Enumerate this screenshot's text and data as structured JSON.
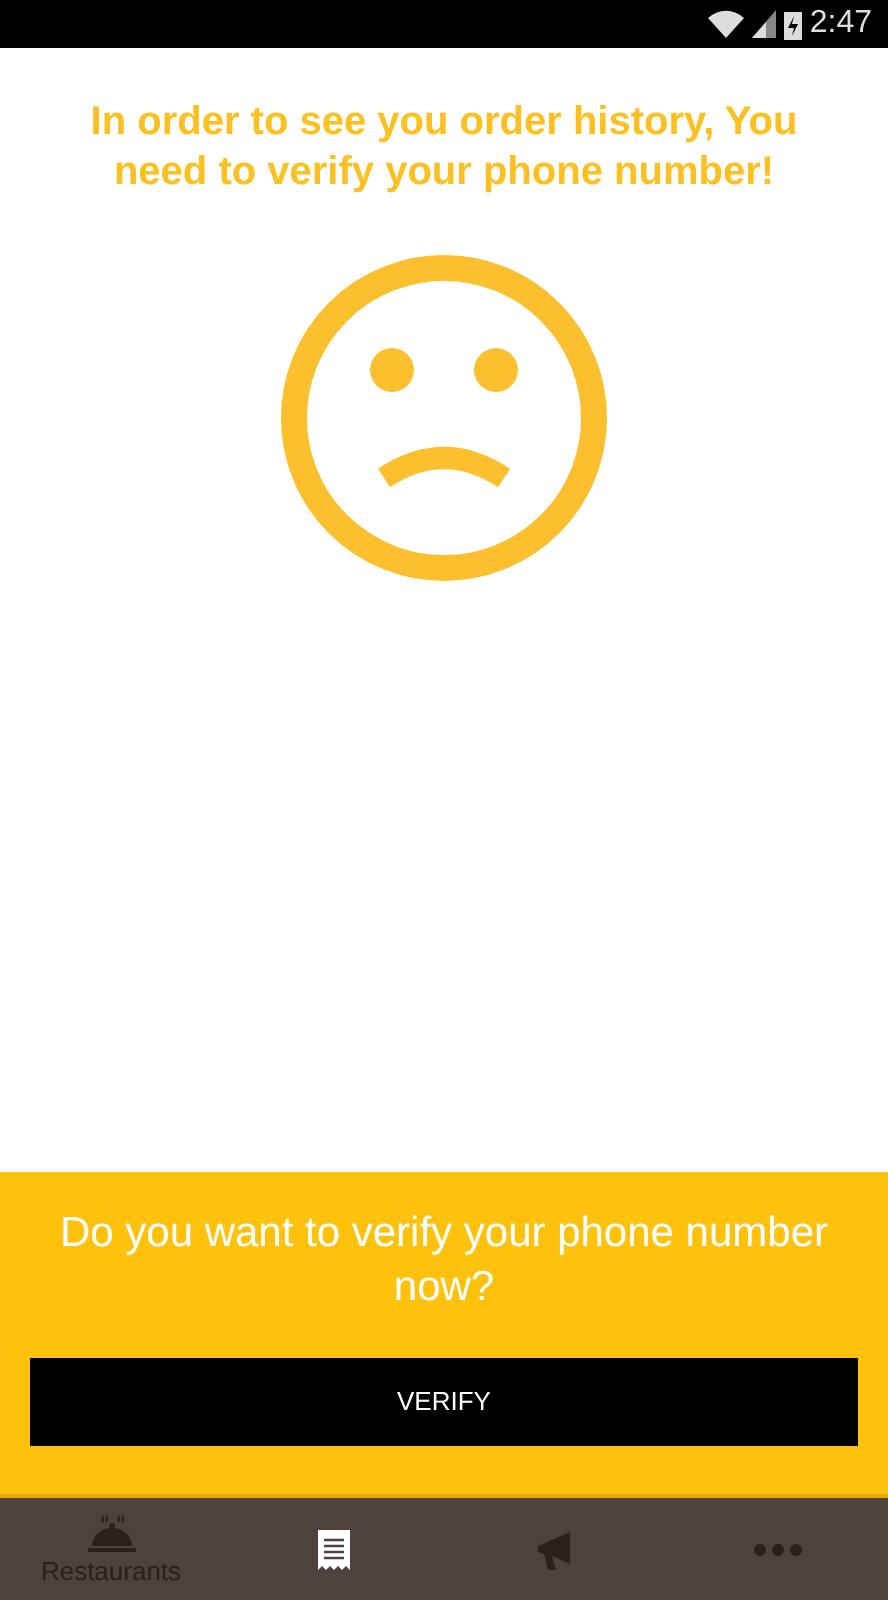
{
  "status_bar": {
    "time": "2:47"
  },
  "message": "In order to see you order history, You need to verify your phone number!",
  "prompt": {
    "question": "Do you want to verify your phone number now?",
    "button": "VERIFY"
  },
  "bottom_nav": [
    {
      "kind": "bell",
      "label": "Restaurants",
      "selected": false
    },
    {
      "kind": "receipt",
      "selected": true
    },
    {
      "kind": "megaphone",
      "selected": false
    },
    {
      "kind": "more",
      "selected": false
    }
  ]
}
